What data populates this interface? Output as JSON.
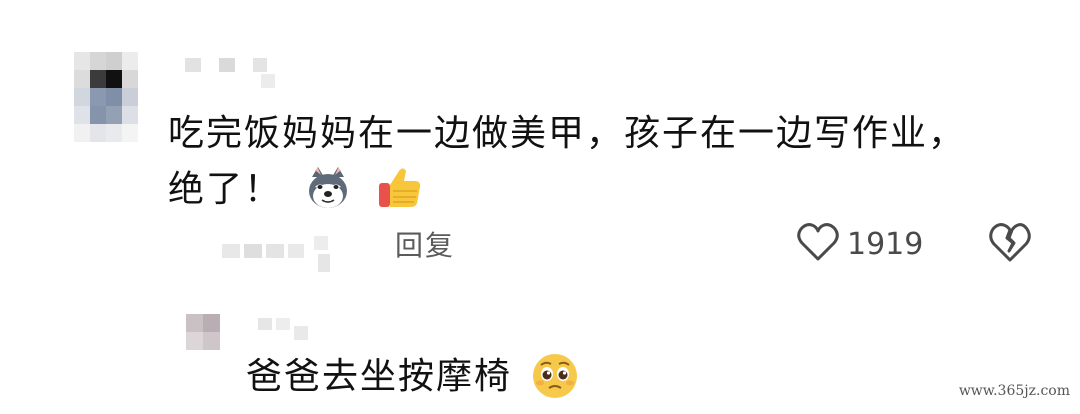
{
  "comment": {
    "text": "吃完饭妈妈在一边做美甲，孩子在一边写作业，绝了！",
    "emoji_1": "husky-dog-face-emoji",
    "emoji_2": "thumbs-up-emoji",
    "reply_label": "回复",
    "like_count": "1919"
  },
  "reply": {
    "text": "爸爸去坐按摩椅",
    "emoji": "pleading-face-emoji"
  },
  "watermark": "www.365jz.com",
  "colors": {
    "text": "#111111",
    "secondary_text": "#5b5b5b",
    "icon": "#4a4a4a"
  }
}
